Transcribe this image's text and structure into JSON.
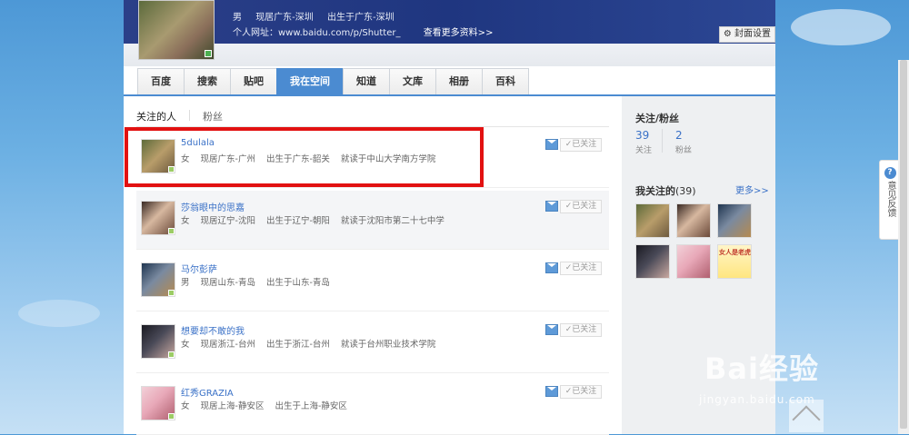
{
  "profile": {
    "gender": "男",
    "residence": "现居广东-深圳",
    "birthplace": "出生于广东-深圳",
    "homepage_prefix": "个人网址：",
    "homepage_url": "www.baidu.com/p/Shutter_",
    "more_info": "查看更多资料>>",
    "cover_settings": "封面设置"
  },
  "nav": {
    "tabs": [
      {
        "label": "百度"
      },
      {
        "label": "搜索"
      },
      {
        "label": "贴吧"
      },
      {
        "label": "我在空间"
      },
      {
        "label": "知道"
      },
      {
        "label": "文库"
      },
      {
        "label": "相册"
      },
      {
        "label": "百科"
      }
    ],
    "active_index": 3
  },
  "subtabs": {
    "following": "关注的人",
    "fans": "粉丝"
  },
  "follow_list": [
    {
      "name": "5dulala",
      "gender": "女",
      "residence": "现居广东-广州",
      "birthplace": "出生于广东-韶关",
      "school": "就读于中山大学南方学院",
      "button": "已关注"
    },
    {
      "name": "莎翁眼中的思嘉",
      "gender": "女",
      "residence": "现居辽宁-沈阳",
      "birthplace": "出生于辽宁-朝阳",
      "school": "就读于沈阳市第二十七中学",
      "button": "已关注"
    },
    {
      "name": "马尔彭萨",
      "gender": "男",
      "residence": "现居山东-青岛",
      "birthplace": "出生于山东-青岛",
      "school": "",
      "button": "已关注"
    },
    {
      "name": "想要却不敢的我",
      "gender": "女",
      "residence": "现居浙江-台州",
      "birthplace": "出生于浙江-台州",
      "school": "就读于台州职业技术学院",
      "button": "已关注"
    },
    {
      "name": "红秀GRAZIA",
      "gender": "女",
      "residence": "现居上海-静安区",
      "birthplace": "出生于上海-静安区",
      "school": "",
      "button": "已关注"
    }
  ],
  "sidebar": {
    "heading": "关注/粉丝",
    "following_count": "39",
    "following_label": "关注",
    "fans_count": "2",
    "fans_label": "粉丝",
    "my_following_title": "我关注的",
    "my_following_count": "(39)",
    "more": "更多>>",
    "thumb_caption": "女人是老虎"
  },
  "feedback": {
    "icon": "?",
    "label": "意见反馈"
  },
  "watermark": {
    "brand": "Bai经验",
    "url": "jingyan.baidu.com"
  },
  "colors": {
    "accent": "#4b8bd1",
    "link": "#3a71c7",
    "highlight_box": "#e21111"
  }
}
